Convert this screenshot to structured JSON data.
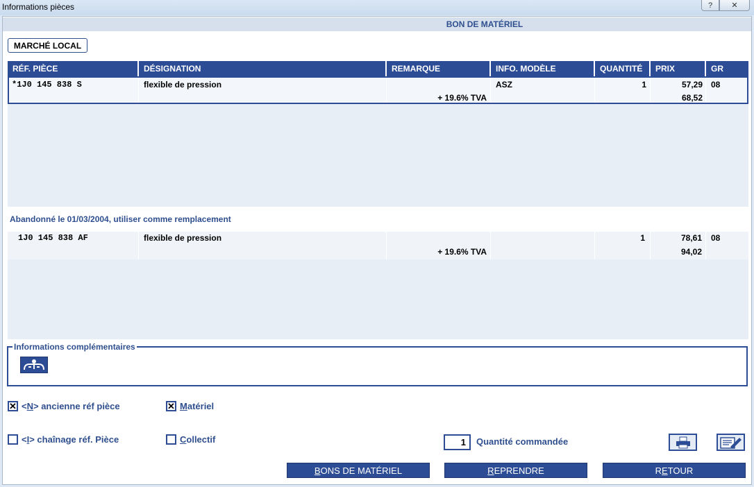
{
  "window": {
    "title": "Informations pièces",
    "help_glyph": "?",
    "close_glyph": "✕"
  },
  "header": {
    "title": "BON DE MATÉRIEL"
  },
  "tab": {
    "label": "MARCHÉ LOCAL"
  },
  "columns": {
    "ref": "RÉF. PIÈCE",
    "designation": "DÉSIGNATION",
    "remarque": "REMARQUE",
    "info": "INFO. MODÈLE",
    "quantite": "QUANTITÉ",
    "prix": "PRIX",
    "gr": "GR"
  },
  "rows": [
    {
      "ref": "*1J0 145 838 S",
      "designation": "flexible de pression",
      "remarque": "+ 19.6% TVA",
      "info": "ASZ",
      "quantite": "1",
      "prix": "57,29",
      "prix_ttc": "68,52",
      "gr": "08"
    }
  ],
  "abandon_note": "Abandonné le 01/03/2004, utiliser comme remplacement",
  "replacement_rows": [
    {
      "ref": "1J0 145 838 AF",
      "designation": "flexible de pression",
      "remarque": "+ 19.6% TVA",
      "info": "",
      "quantite": "1",
      "prix": "78,61",
      "prix_ttc": "94,02",
      "gr": "08"
    }
  ],
  "info_section": {
    "legend": "Informations complémentaires",
    "icon": "mechanic-icon"
  },
  "options": {
    "ancienne_ref": {
      "prefix": "<",
      "key": "N",
      "label": "> ancienne réf pièce",
      "checked": true,
      "mark": "✕"
    },
    "materiel": {
      "key": "M",
      "label": "atériel",
      "checked": true,
      "mark": "✕"
    },
    "chainage": {
      "prefix": "<",
      "key": "I",
      "label": "> chaînage réf. Pièce",
      "checked": false
    },
    "collectif": {
      "key": "C",
      "label": "ollectif",
      "checked": false
    }
  },
  "quantity": {
    "value": "1",
    "label": "Quantité commandée"
  },
  "icons": {
    "print": "printer-icon",
    "edit": "edit-notes-icon"
  },
  "buttons": {
    "bons": {
      "key": "B",
      "label": "ONS DE MATÉRIEL"
    },
    "reprendre": {
      "key": "R",
      "label": "EPRENDRE"
    },
    "retour_pre": "R",
    "retour_key": "E",
    "retour_post": "TOUR"
  },
  "colors": {
    "accent": "#2c4c96",
    "label_text": "#2f4f8f"
  }
}
